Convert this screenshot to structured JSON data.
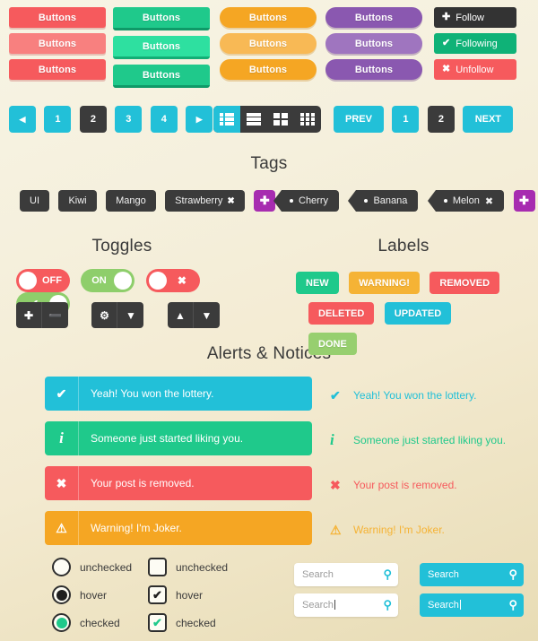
{
  "buttons": {
    "columns": [
      {
        "style": "red",
        "shape": "square",
        "items": [
          {
            "label": "Buttons",
            "state": "normal"
          },
          {
            "label": "Buttons",
            "state": "hover"
          },
          {
            "label": "Buttons",
            "state": "active"
          }
        ]
      },
      {
        "style": "green",
        "shape": "square",
        "items": [
          {
            "label": "Buttons",
            "state": "normal"
          },
          {
            "label": "Buttons",
            "state": "hover"
          },
          {
            "label": "Buttons",
            "state": "active"
          }
        ]
      },
      {
        "style": "orange",
        "shape": "pill",
        "items": [
          {
            "label": "Buttons",
            "state": "normal"
          },
          {
            "label": "Buttons",
            "state": "hover"
          },
          {
            "label": "Buttons",
            "state": "active"
          }
        ]
      },
      {
        "style": "purple",
        "shape": "pill",
        "items": [
          {
            "label": "Buttons",
            "state": "normal"
          },
          {
            "label": "Buttons",
            "state": "hover"
          },
          {
            "label": "Buttons",
            "state": "active"
          }
        ]
      }
    ],
    "social": [
      {
        "label": "Follow",
        "icon": "plus-icon",
        "glyph": "✚",
        "color": "#333333"
      },
      {
        "label": "Following",
        "icon": "check-icon",
        "glyph": "✔",
        "color": "#0fb277"
      },
      {
        "label": "Unfollow",
        "icon": "cross-icon",
        "glyph": "✖",
        "color": "#f65a5d"
      }
    ]
  },
  "pagination": {
    "left": [
      {
        "label": "◀",
        "name": "prev-arrow",
        "active": false
      },
      {
        "label": "1",
        "name": "page-1",
        "active": false
      },
      {
        "label": "2",
        "name": "page-2",
        "active": true
      },
      {
        "label": "3",
        "name": "page-3",
        "active": false
      },
      {
        "label": "4",
        "name": "page-4",
        "active": false
      },
      {
        "label": "▶",
        "name": "next-arrow",
        "active": false
      }
    ],
    "views": [
      {
        "icon": "list-view-icon",
        "active": true
      },
      {
        "icon": "lines-view-icon",
        "active": false
      },
      {
        "icon": "grid-2x2-view-icon",
        "active": false
      },
      {
        "icon": "grid-3x3-view-icon",
        "active": false
      }
    ],
    "right": [
      {
        "label": "PREV",
        "name": "prev-button",
        "active": false,
        "wide": true
      },
      {
        "label": "1",
        "name": "page-1",
        "active": false,
        "wide": false
      },
      {
        "label": "2",
        "name": "page-2",
        "active": true,
        "wide": false
      },
      {
        "label": "NEXT",
        "name": "next-button",
        "active": false,
        "wide": true
      }
    ]
  },
  "headings": {
    "tags": "Tags",
    "toggles": "Toggles",
    "labels": "Labels",
    "alerts": "Alerts & Notices"
  },
  "tags": {
    "square": [
      {
        "label": "UI",
        "removable": false
      },
      {
        "label": "Kiwi",
        "removable": false
      },
      {
        "label": "Mango",
        "removable": false
      },
      {
        "label": "Strawberry",
        "removable": true
      }
    ],
    "square_add": "✚",
    "ribbon": [
      {
        "label": "Cherry",
        "removable": false
      },
      {
        "label": "Banana",
        "removable": false
      },
      {
        "label": "Melon",
        "removable": true
      }
    ],
    "ribbon_add": "✚",
    "remove_glyph": "✖"
  },
  "toggles": {
    "switches": [
      {
        "name": "toggle-off",
        "color": "red",
        "text": "OFF",
        "knob": "left",
        "icon": null
      },
      {
        "name": "toggle-on",
        "color": "green",
        "text": "ON",
        "knob": "right",
        "icon": null
      },
      {
        "name": "toggle-cross",
        "color": "red",
        "text": null,
        "knob": "left",
        "icon": "✖"
      },
      {
        "name": "toggle-check",
        "color": "green",
        "text": null,
        "knob": "right",
        "icon": "✔"
      }
    ],
    "steppers": [
      {
        "name": "plus-minus-stepper",
        "buttons": [
          {
            "glyph": "✚",
            "icon": "plus-icon"
          },
          {
            "glyph": "➖",
            "icon": "minus-icon"
          }
        ]
      },
      {
        "name": "settings-stepper",
        "buttons": [
          {
            "glyph": "⚙",
            "icon": "gear-icon"
          },
          {
            "glyph": "▼",
            "icon": "chevron-down-icon"
          }
        ]
      },
      {
        "name": "updown-stepper",
        "buttons": [
          {
            "glyph": "▲",
            "icon": "chevron-up-icon"
          },
          {
            "glyph": "▼",
            "icon": "chevron-down-icon"
          }
        ]
      }
    ]
  },
  "labels": {
    "row1": [
      {
        "text": "NEW",
        "color": "#1fc98b"
      },
      {
        "text": "WARNING!",
        "color": "#f5b335"
      },
      {
        "text": "REMOVED",
        "color": "#f65a5d"
      }
    ],
    "row2": [
      {
        "text": "DELETED",
        "color": "#f65a5d"
      },
      {
        "text": "UPDATED",
        "color": "#22c0d8"
      },
      {
        "text": "DONE",
        "color": "#97cf6f"
      }
    ]
  },
  "alerts": {
    "banners": [
      {
        "icon": "check-icon",
        "glyph": "✔",
        "text": "Yeah! You won the lottery.",
        "color": "#22c0d8"
      },
      {
        "icon": "info-icon",
        "glyph": "i",
        "text": "Someone just started liking you.",
        "color": "#1fc98b"
      },
      {
        "icon": "cross-icon",
        "glyph": "✖",
        "text": "Your post is removed.",
        "color": "#f65a5d"
      },
      {
        "icon": "warning-icon",
        "glyph": "⚠",
        "text": "Warning! I'm Joker.",
        "color": "#f5a623"
      }
    ],
    "notices": [
      {
        "icon": "check-icon",
        "glyph": "✔",
        "text": "Yeah! You won the lottery.",
        "color": "#22c0d8"
      },
      {
        "icon": "info-icon",
        "glyph": "i",
        "text": "Someone just started liking you.",
        "color": "#1fc98b"
      },
      {
        "icon": "cross-icon",
        "glyph": "✖",
        "text": "Your post is removed.",
        "color": "#f65a5d"
      },
      {
        "icon": "warning-icon",
        "glyph": "⚠",
        "text": "Warning! I'm Joker.",
        "color": "#f5b335"
      }
    ]
  },
  "form": {
    "radios": [
      {
        "label": "unchecked",
        "state": "unchecked"
      },
      {
        "label": "hover",
        "state": "hover"
      },
      {
        "label": "checked",
        "state": "checked"
      }
    ],
    "checkboxes": [
      {
        "label": "unchecked",
        "state": "unchecked",
        "glyph": ""
      },
      {
        "label": "hover",
        "state": "hover",
        "glyph": "✔"
      },
      {
        "label": "checked",
        "state": "checked",
        "glyph": "✔"
      }
    ],
    "searches": [
      {
        "name": "search-light",
        "value": "Search",
        "theme": "light",
        "focused": false
      },
      {
        "name": "search-light-focused",
        "value": "Search",
        "theme": "light",
        "focused": true
      },
      {
        "name": "search-cyan",
        "value": "Search",
        "theme": "cyan",
        "focused": false
      },
      {
        "name": "search-cyan-focused",
        "value": "Search",
        "theme": "cyan",
        "focused": true
      }
    ],
    "search_icon_glyph": "⚲"
  }
}
